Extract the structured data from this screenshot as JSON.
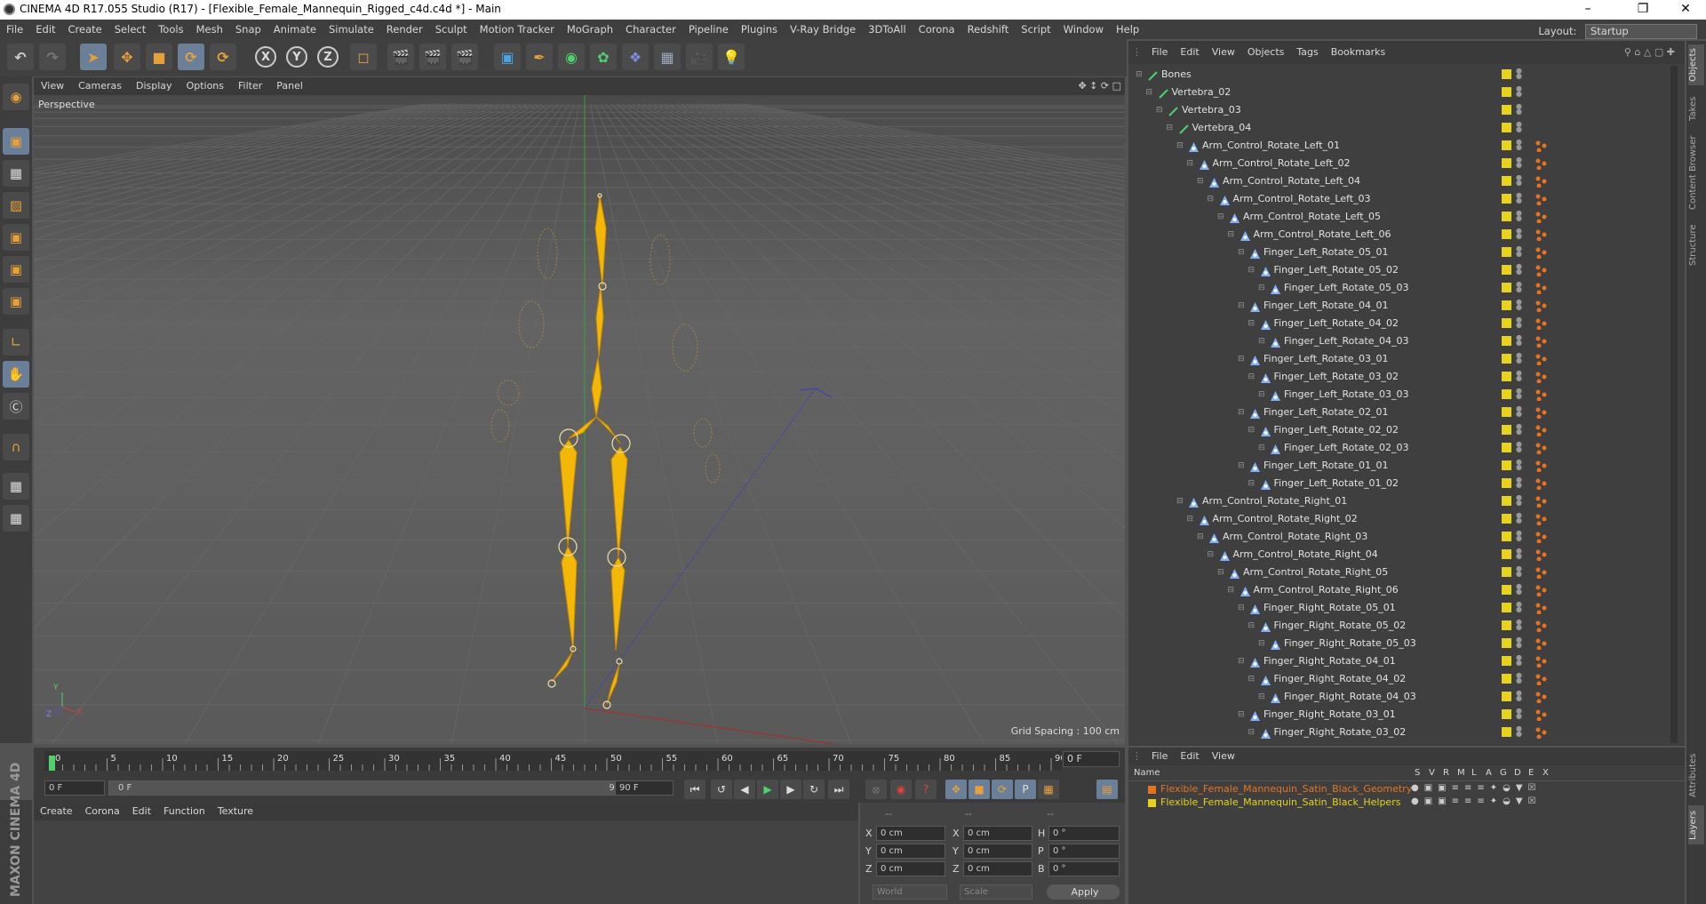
{
  "window": {
    "title": "CINEMA 4D R17.055 Studio (R17) - [Flexible_Female_Mannequin_Rigged_c4d.c4d *] - Main"
  },
  "menubar": {
    "items": [
      "File",
      "Edit",
      "Create",
      "Select",
      "Tools",
      "Mesh",
      "Snap",
      "Animate",
      "Simulate",
      "Render",
      "Sculpt",
      "Motion Tracker",
      "MoGraph",
      "Character",
      "Pipeline",
      "Plugins",
      "V-Ray Bridge",
      "3DToAll",
      "Corona",
      "Redshift",
      "Script",
      "Window",
      "Help"
    ],
    "layout_label": "Layout:",
    "layout_value": "Startup"
  },
  "toolbar": {
    "axis_x": "X",
    "axis_y": "Y",
    "axis_z": "Z"
  },
  "viewport": {
    "menu": [
      "View",
      "Cameras",
      "Display",
      "Options",
      "Filter",
      "Panel"
    ],
    "label": "Perspective",
    "grid_spacing": "Grid Spacing : 100 cm",
    "axis_labels": {
      "x": "X",
      "y": "Y",
      "z": "Z"
    }
  },
  "timeline": {
    "ticks": [
      "0",
      "5",
      "10",
      "15",
      "20",
      "25",
      "30",
      "35",
      "40",
      "45",
      "50",
      "55",
      "60",
      "65",
      "70",
      "75",
      "80",
      "85",
      "90"
    ],
    "current_frame": "0 F"
  },
  "transport": {
    "start": "0 F",
    "range_start": "0 F",
    "range_end": "90 F",
    "end": "90 F"
  },
  "material_manager": {
    "menu": [
      "Create",
      "Corona",
      "Edit",
      "Function",
      "Texture"
    ]
  },
  "coordinates": {
    "headers": [
      "--",
      "--",
      "--"
    ],
    "pos": [
      {
        "axis": "X",
        "value": "0 cm"
      },
      {
        "axis": "Y",
        "value": "0 cm"
      },
      {
        "axis": "Z",
        "value": "0 cm"
      }
    ],
    "size": [
      {
        "axis": "X",
        "value": "0 cm"
      },
      {
        "axis": "Y",
        "value": "0 cm"
      },
      {
        "axis": "Z",
        "value": "0 cm"
      }
    ],
    "rot": [
      {
        "axis": "H",
        "value": "0 °"
      },
      {
        "axis": "P",
        "value": "0 °"
      },
      {
        "axis": "B",
        "value": "0 °"
      }
    ],
    "mode1": "World",
    "mode2": "Scale",
    "apply": "Apply"
  },
  "object_manager": {
    "menu": [
      "File",
      "Edit",
      "View",
      "Objects",
      "Tags",
      "Bookmarks"
    ],
    "rows": [
      {
        "name": "Bones",
        "level": 0,
        "type": "bone"
      },
      {
        "name": "Vertebra_02",
        "level": 1,
        "type": "bone"
      },
      {
        "name": "Vertebra_03",
        "level": 2,
        "type": "bone"
      },
      {
        "name": "Vertebra_04",
        "level": 3,
        "type": "bone"
      },
      {
        "name": "Arm_Control_Rotate_Left_01",
        "level": 4,
        "type": "joint"
      },
      {
        "name": "Arm_Control_Rotate_Left_02",
        "level": 5,
        "type": "joint"
      },
      {
        "name": "Arm_Control_Rotate_Left_04",
        "level": 6,
        "type": "joint"
      },
      {
        "name": "Arm_Control_Rotate_Left_03",
        "level": 7,
        "type": "joint"
      },
      {
        "name": "Arm_Control_Rotate_Left_05",
        "level": 8,
        "type": "joint"
      },
      {
        "name": "Arm_Control_Rotate_Left_06",
        "level": 9,
        "type": "joint"
      },
      {
        "name": "Finger_Left_Rotate_05_01",
        "level": 10,
        "type": "joint"
      },
      {
        "name": "Finger_Left_Rotate_05_02",
        "level": 11,
        "type": "joint"
      },
      {
        "name": "Finger_Left_Rotate_05_03",
        "level": 12,
        "type": "joint"
      },
      {
        "name": "Finger_Left_Rotate_04_01",
        "level": 10,
        "type": "joint"
      },
      {
        "name": "Finger_Left_Rotate_04_02",
        "level": 11,
        "type": "joint"
      },
      {
        "name": "Finger_Left_Rotate_04_03",
        "level": 12,
        "type": "joint"
      },
      {
        "name": "Finger_Left_Rotate_03_01",
        "level": 10,
        "type": "joint"
      },
      {
        "name": "Finger_Left_Rotate_03_02",
        "level": 11,
        "type": "joint"
      },
      {
        "name": "Finger_Left_Rotate_03_03",
        "level": 12,
        "type": "joint"
      },
      {
        "name": "Finger_Left_Rotate_02_01",
        "level": 10,
        "type": "joint"
      },
      {
        "name": "Finger_Left_Rotate_02_02",
        "level": 11,
        "type": "joint"
      },
      {
        "name": "Finger_Left_Rotate_02_03",
        "level": 12,
        "type": "joint"
      },
      {
        "name": "Finger_Left_Rotate_01_01",
        "level": 10,
        "type": "joint"
      },
      {
        "name": "Finger_Left_Rotate_01_02",
        "level": 11,
        "type": "joint"
      },
      {
        "name": "Arm_Control_Rotate_Right_01",
        "level": 4,
        "type": "joint"
      },
      {
        "name": "Arm_Control_Rotate_Right_02",
        "level": 5,
        "type": "joint"
      },
      {
        "name": "Arm_Control_Rotate_Right_03",
        "level": 6,
        "type": "joint"
      },
      {
        "name": "Arm_Control_Rotate_Right_04",
        "level": 7,
        "type": "joint"
      },
      {
        "name": "Arm_Control_Rotate_Right_05",
        "level": 8,
        "type": "joint"
      },
      {
        "name": "Arm_Control_Rotate_Right_06",
        "level": 9,
        "type": "joint"
      },
      {
        "name": "Finger_Right_Rotate_05_01",
        "level": 10,
        "type": "joint"
      },
      {
        "name": "Finger_Right_Rotate_05_02",
        "level": 11,
        "type": "joint"
      },
      {
        "name": "Finger_Right_Rotate_05_03",
        "level": 12,
        "type": "joint"
      },
      {
        "name": "Finger_Right_Rotate_04_01",
        "level": 10,
        "type": "joint"
      },
      {
        "name": "Finger_Right_Rotate_04_02",
        "level": 11,
        "type": "joint"
      },
      {
        "name": "Finger_Right_Rotate_04_03",
        "level": 12,
        "type": "joint"
      },
      {
        "name": "Finger_Right_Rotate_03_01",
        "level": 10,
        "type": "joint"
      },
      {
        "name": "Finger_Right_Rotate_03_02",
        "level": 11,
        "type": "joint"
      }
    ]
  },
  "layer_manager": {
    "menu": [
      "File",
      "Edit",
      "View"
    ],
    "headers": {
      "name": "Name",
      "flags": [
        "S",
        "V",
        "R",
        "M",
        "L",
        "A",
        "G",
        "D",
        "E",
        "X"
      ]
    },
    "rows": [
      {
        "name": "Flexible_Female_Mannequin_Satin_Black_Geometry",
        "color": "#e6731f"
      },
      {
        "name": "Flexible_Female_Mannequin_Satin_Black_Helpers",
        "color": "#e6d21f"
      }
    ]
  },
  "right_tabs": [
    "Objects",
    "Takes",
    "Content Browser",
    "Structure",
    "Attributes",
    "Layers"
  ],
  "colors": {
    "accent": "#e8a13a",
    "bone_yellow": "#f2b707",
    "selected_tab": "#6b7f99"
  }
}
